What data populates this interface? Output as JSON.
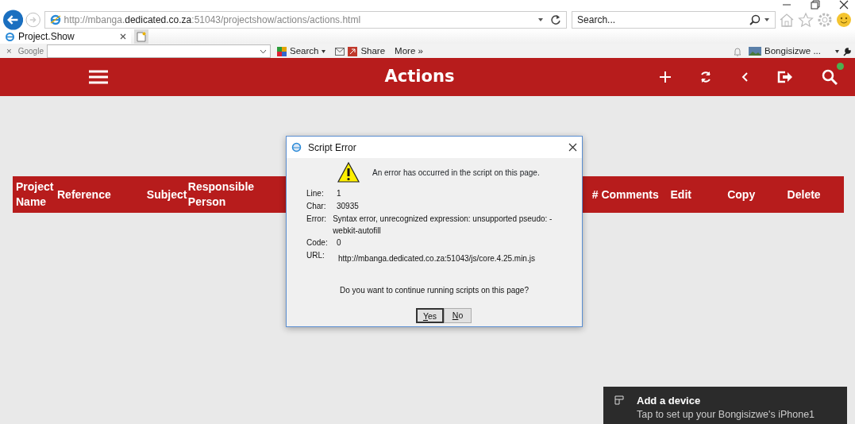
{
  "browser": {
    "address": "http://mbanga.**dedicated.co.za**:51043/projectshow/actions/actions.html",
    "search": {
      "placeholder": "Search..."
    },
    "tabs": [
      {
        "label": "Project.Show",
        "selected": true
      }
    ],
    "toolbar": {
      "close": "×",
      "logo": "Google",
      "items": [
        {
          "kind": "search",
          "label": "Search"
        },
        {
          "kind": "share",
          "label": "Share"
        },
        {
          "kind": "more",
          "label": "More »"
        }
      ],
      "user": "Bongisizwe ..."
    }
  },
  "app": {
    "title": "Actions",
    "online": true
  },
  "table": {
    "columns": [
      {
        "label": "Project Name"
      },
      {
        "label": "Reference"
      },
      {
        "label": "Subject"
      },
      {
        "label": "Responsible Person"
      },
      {
        "label": "# Comments"
      },
      {
        "label": "Edit"
      },
      {
        "label": "Copy"
      },
      {
        "label": "Delete"
      }
    ]
  },
  "dialog": {
    "title": "Script Error",
    "message": "An error has occurred in the script on this page.",
    "fields": [
      {
        "label": "Line:",
        "value": "1"
      },
      {
        "label": "Char:",
        "value": "30935"
      },
      {
        "label": "Error:",
        "value": "Syntax error, unrecognized expression: unsupported pseudo: -webkit-autofill"
      },
      {
        "label": "Code:",
        "value": "0"
      },
      {
        "label": "URL:",
        "value": "http://mbanga.dedicated.co.za:51043/js/core.4.25.min.js"
      }
    ],
    "question": "Do you want to continue running scripts on this page?",
    "buttons": [
      {
        "label": "Yes",
        "default": true
      },
      {
        "label": "No",
        "default": false
      }
    ]
  },
  "toast": {
    "title": "Add a device",
    "text": "Tap to set up your Bongisizwe's iPhone1"
  }
}
